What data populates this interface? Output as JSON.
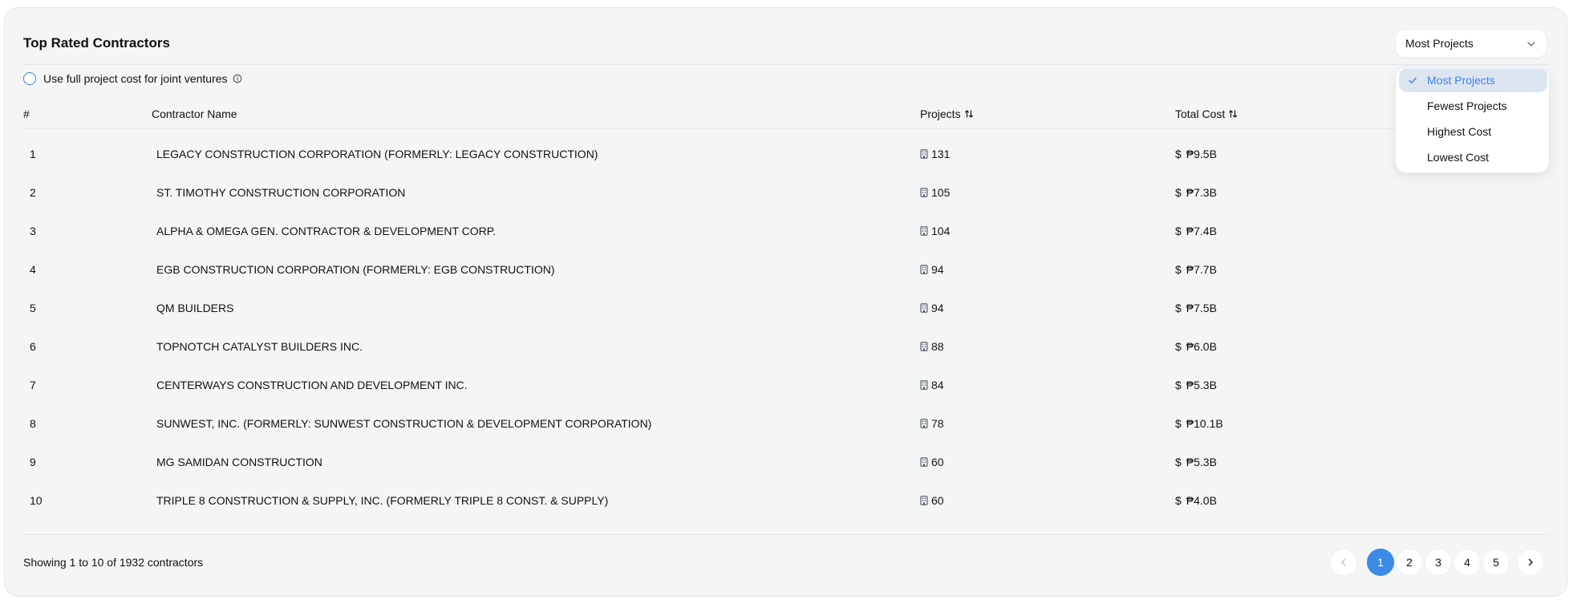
{
  "title": "Top Rated Contractors",
  "sort": {
    "selected": "Most Projects",
    "options": [
      "Most Projects",
      "Fewest Projects",
      "Highest Cost",
      "Lowest Cost"
    ]
  },
  "toggle": {
    "label": "Use full project cost for joint ventures"
  },
  "table": {
    "columns": [
      "#",
      "Contractor Name",
      "Projects",
      "Total Cost"
    ],
    "rows": [
      {
        "rank": "1",
        "name": "LEGACY CONSTRUCTION CORPORATION (FORMERLY: LEGACY CONSTRUCTION)",
        "projects": "131",
        "cost": "₱9.5B"
      },
      {
        "rank": "2",
        "name": "ST. TIMOTHY CONSTRUCTION CORPORATION",
        "projects": "105",
        "cost": "₱7.3B"
      },
      {
        "rank": "3",
        "name": "ALPHA & OMEGA GEN. CONTRACTOR & DEVELOPMENT CORP.",
        "projects": "104",
        "cost": "₱7.4B"
      },
      {
        "rank": "4",
        "name": "EGB CONSTRUCTION CORPORATION (FORMERLY: EGB CONSTRUCTION)",
        "projects": "94",
        "cost": "₱7.7B"
      },
      {
        "rank": "5",
        "name": "QM BUILDERS",
        "projects": "94",
        "cost": "₱7.5B"
      },
      {
        "rank": "6",
        "name": "TOPNOTCH CATALYST BUILDERS INC.",
        "projects": "88",
        "cost": "₱6.0B"
      },
      {
        "rank": "7",
        "name": "CENTERWAYS CONSTRUCTION AND DEVELOPMENT INC.",
        "projects": "84",
        "cost": "₱5.3B"
      },
      {
        "rank": "8",
        "name": "SUNWEST, INC. (FORMERLY: SUNWEST CONSTRUCTION & DEVELOPMENT CORPORATION)",
        "projects": "78",
        "cost": "₱10.1B"
      },
      {
        "rank": "9",
        "name": "MG SAMIDAN CONSTRUCTION",
        "projects": "60",
        "cost": "₱5.3B"
      },
      {
        "rank": "10",
        "name": "TRIPLE 8 CONSTRUCTION & SUPPLY, INC. (FORMERLY TRIPLE 8 CONST. & SUPPLY)",
        "projects": "60",
        "cost": "₱4.0B"
      }
    ],
    "currency_symbol": "$"
  },
  "footer": {
    "showing": "Showing 1 to 10 of 1932 contractors",
    "pages": [
      "1",
      "2",
      "3",
      "4",
      "5"
    ],
    "current_page": "1"
  },
  "colors": {
    "accent": "#3b8ae6",
    "card_bg": "#f4f5f5",
    "selected_bg": "#dde6f0"
  },
  "icons": {
    "chevron": "chevron-down-icon",
    "info": "info-icon",
    "sort": "sort-arrows-icon",
    "building": "building-icon",
    "check": "check-icon",
    "prev": "chevron-left-icon",
    "next": "chevron-right-icon"
  }
}
